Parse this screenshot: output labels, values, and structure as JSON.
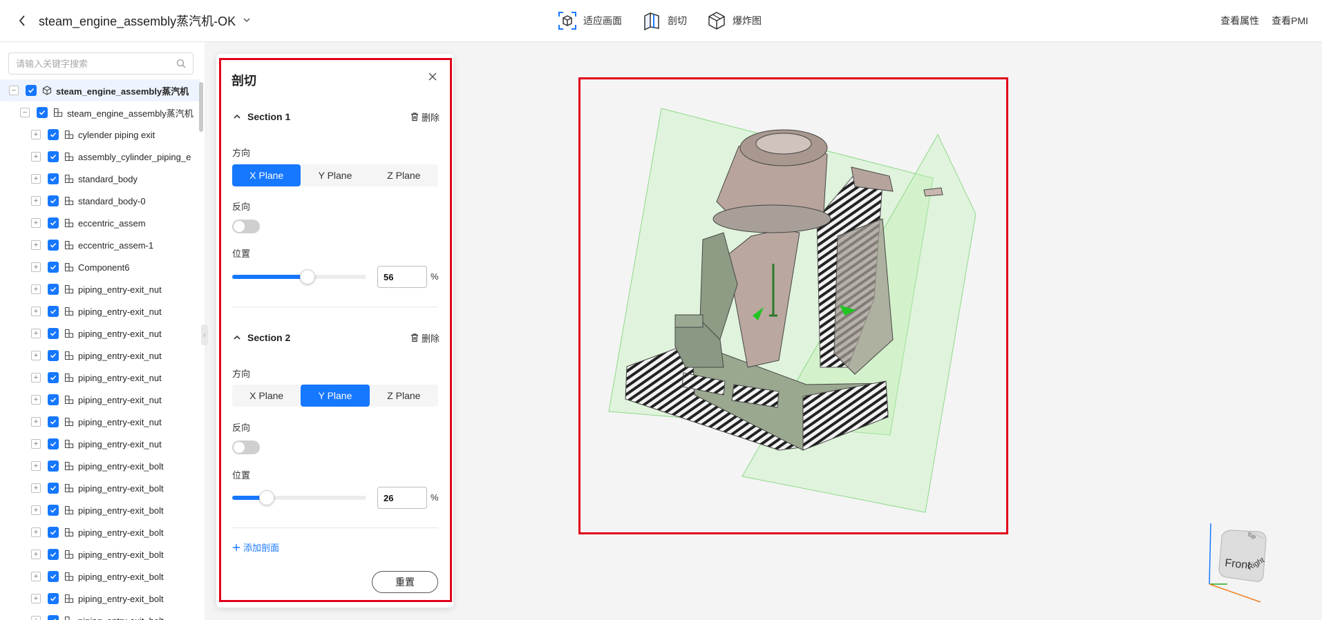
{
  "header": {
    "title": "steam_engine_assembly蒸汽机-OK",
    "tools": [
      {
        "label": "适应画面",
        "icon": "fit-view-icon"
      },
      {
        "label": "剖切",
        "icon": "section-icon"
      },
      {
        "label": "爆炸图",
        "icon": "explode-icon"
      }
    ],
    "right": [
      "查看属性",
      "查看PMI"
    ]
  },
  "sidebar": {
    "search_placeholder": "请输入关键字搜索",
    "root": "steam_engine_assembly蒸汽机",
    "child": "steam_engine_assembly蒸汽机",
    "items": [
      "cylender piping exit",
      "assembly_cylinder_piping_e",
      "standard_body",
      "standard_body-0",
      "eccentric_assem",
      "eccentric_assem-1",
      "Component6",
      "piping_entry-exit_nut",
      "piping_entry-exit_nut",
      "piping_entry-exit_nut",
      "piping_entry-exit_nut",
      "piping_entry-exit_nut",
      "piping_entry-exit_nut",
      "piping_entry-exit_nut",
      "piping_entry-exit_nut",
      "piping_entry-exit_bolt",
      "piping_entry-exit_bolt",
      "piping_entry-exit_bolt",
      "piping_entry-exit_bolt",
      "piping_entry-exit_bolt",
      "piping_entry-exit_bolt",
      "piping_entry-exit_bolt",
      "piping_entry-exit_bolt"
    ]
  },
  "panel": {
    "title": "剖切",
    "delete_label": "删除",
    "direction_label": "方向",
    "reverse_label": "反向",
    "position_label": "位置",
    "planes": [
      "X Plane",
      "Y Plane",
      "Z Plane"
    ],
    "unit": "%",
    "sections": [
      {
        "name": "Section 1",
        "active_plane": "X Plane",
        "reverse": false,
        "position": 56
      },
      {
        "name": "Section 2",
        "active_plane": "Y Plane",
        "reverse": false,
        "position": 26
      }
    ],
    "add_label": "添加剖面",
    "reset_label": "重置"
  },
  "view_cube": {
    "front": "Front",
    "right": "Right",
    "top": "Top"
  },
  "colors": {
    "accent": "#1677ff",
    "highlight": "#e0001a",
    "plane": "#b9f0b0"
  }
}
